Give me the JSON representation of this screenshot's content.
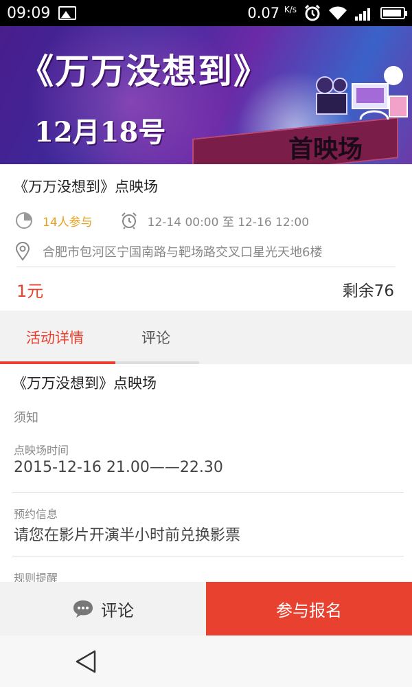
{
  "status_bar": {
    "time": "09:09",
    "speed": "0.07",
    "speed_unit": "K/s",
    "icons": [
      "image-icon",
      "alarm-icon",
      "wifi-icon",
      "signal-icon",
      "battery-icon"
    ]
  },
  "banner": {
    "title": "《万万没想到》",
    "date": "12月18号",
    "badge": "首映场"
  },
  "event": {
    "title": "《万万没想到》点映场",
    "participants": "14人参与",
    "time_range": "12-14 00:00 至 12-16 12:00",
    "location": "合肥市包河区宁国南路与靶场路交叉口星光天地6楼",
    "price": "1元",
    "remaining": "剩余76"
  },
  "tabs": [
    {
      "label": "活动详情",
      "active": true
    },
    {
      "label": "评论",
      "active": false
    }
  ],
  "details": {
    "title": "《万万没想到》点映场",
    "notice": "须知",
    "sections": [
      {
        "label": "点映场时间",
        "value": "2015-12-16  21.00——22.30"
      },
      {
        "label": "预约信息",
        "value": "请您在影片开演半小时前兑换影票"
      },
      {
        "label": "规则提醒",
        "value": ""
      }
    ]
  },
  "actions": {
    "comment_label": "评论",
    "signup_label": "参与报名"
  },
  "colors": {
    "accent": "#e8412f",
    "participants": "#e7a21d"
  }
}
